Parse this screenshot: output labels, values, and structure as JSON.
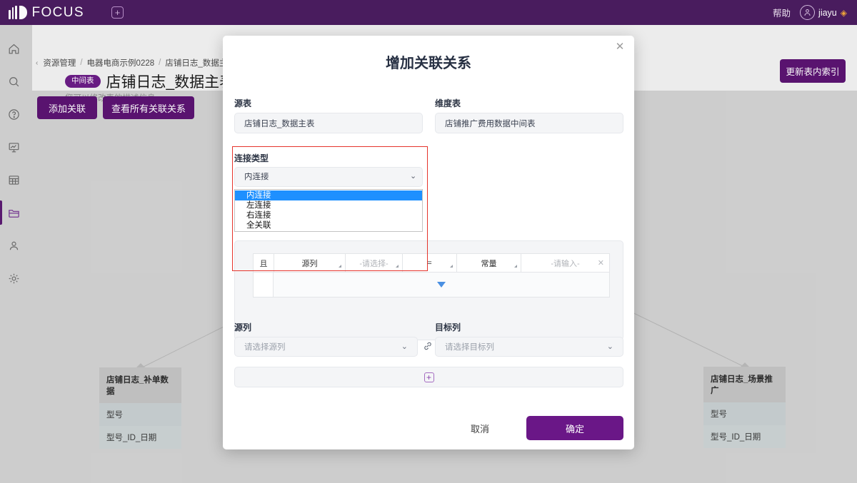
{
  "topbar": {
    "brand": "FOCUS",
    "add_tab_icon": "plus-square-icon",
    "help_label": "帮助",
    "user_name": "jiayu",
    "gem_icon": "gem-icon"
  },
  "rail": {
    "items": [
      {
        "name": "home-icon",
        "label": "首页",
        "active": false
      },
      {
        "name": "search-icon",
        "label": "搜索",
        "active": false
      },
      {
        "name": "help-circle-icon",
        "label": "帮助",
        "active": false
      },
      {
        "name": "chart-board-icon",
        "label": "看板",
        "active": false
      },
      {
        "name": "table-grid-icon",
        "label": "表格",
        "active": false
      },
      {
        "name": "folder-icon",
        "label": "资源",
        "active": true
      },
      {
        "name": "user-icon",
        "label": "用户",
        "active": false
      },
      {
        "name": "gear-icon",
        "label": "设置",
        "active": false
      }
    ]
  },
  "page": {
    "breadcrumb": [
      "资源管理",
      "电器电商示例0228",
      "店铺日志_数据主表"
    ],
    "breadcrumb_sep": "/",
    "badge": "中间表",
    "title": "店铺日志_数据主表",
    "subtitle": "您可以修改表的描述信息",
    "buttons": {
      "add_relation": "添加关联",
      "view_all_relations": "查看所有关联关系",
      "refresh_index": "更新表内索引"
    }
  },
  "canvas_cards": [
    {
      "title": "店铺日志_补单数据",
      "rows": [
        "型号",
        "型号_ID_日期"
      ]
    },
    {
      "title": "店铺日志_场景推广",
      "rows": [
        "型号",
        "型号_ID_日期"
      ]
    }
  ],
  "modal": {
    "title": "增加关联关系",
    "close_icon": "close-icon",
    "source_table": {
      "label": "源表",
      "value": "店铺日志_数据主表"
    },
    "dimension_table": {
      "label": "维度表",
      "value": "店铺推广费用数据中间表"
    },
    "join_type": {
      "label": "连接类型",
      "selected": "内连接",
      "options": [
        "内连接",
        "左连接",
        "右连接",
        "全关联"
      ],
      "open": true,
      "highlight_color": "#e5342c"
    },
    "filter": {
      "and_label": "且",
      "columns": [
        "源列",
        "-请选择-",
        "=",
        "常量",
        "-请输入-"
      ],
      "remove_icon": "close-icon",
      "expand_icon": "triangle-down-icon"
    },
    "source_column": {
      "label": "源列",
      "placeholder": "请选择源列"
    },
    "target_column": {
      "label": "目标列",
      "placeholder": "请选择目标列"
    },
    "link_icon": "link-icon",
    "add_pair_icon": "plus-icon",
    "footer": {
      "cancel": "取消",
      "confirm": "确定"
    }
  },
  "theme": {
    "brand_purple": "#4b1d60",
    "button_purple": "#5b1472",
    "confirm_purple": "#6a1787",
    "highlight_blue": "#1e90ff",
    "canvas_gray": "#d2d2d2"
  }
}
